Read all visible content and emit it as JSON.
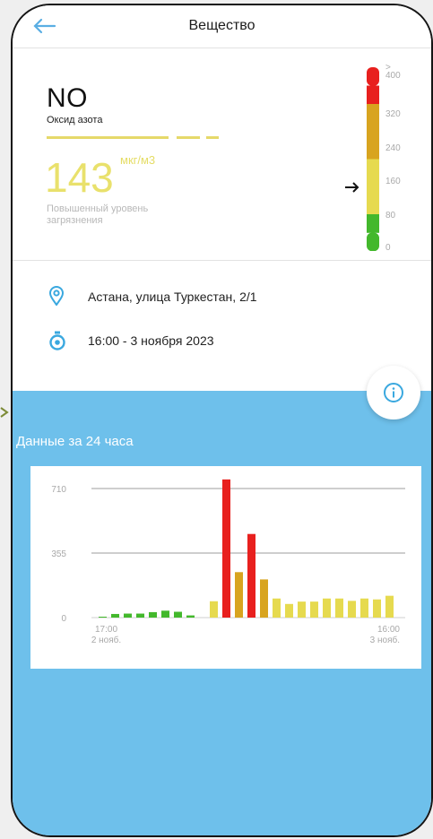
{
  "header": {
    "title": "Вещество",
    "back_icon": "arrow-left-icon"
  },
  "substance": {
    "formula": "NO",
    "name": "Оксид азота",
    "value": "143",
    "unit": "мкг/м3",
    "status": "Повышенный уровень загрязнения",
    "color": "#e9e16c",
    "level_fraction": 0.36
  },
  "scale": {
    "labels": [
      ">\n400",
      "320",
      "240",
      "160",
      "80",
      "0"
    ],
    "segments": [
      {
        "color": "#e8201e"
      },
      {
        "color": "#e8201e"
      },
      {
        "color": "#d8a41f"
      },
      {
        "color": "#d8a41f"
      },
      {
        "color": "#d8a41f"
      },
      {
        "color": "#e6da4f"
      },
      {
        "color": "#e6da4f"
      },
      {
        "color": "#e6da4f"
      },
      {
        "color": "#43b82c"
      },
      {
        "color": "#43b82c"
      }
    ]
  },
  "location": {
    "icon": "location-pin-icon",
    "text": "Астана, улица Туркестан, 2/1"
  },
  "time": {
    "icon": "stopwatch-icon",
    "text": "16:00 - 3 ноября 2023"
  },
  "info_button": {
    "icon": "info-icon"
  },
  "history": {
    "title": "Данные за 24 часа"
  },
  "chart_data": {
    "type": "bar",
    "ylim": [
      0,
      710
    ],
    "y_ticks": [
      "710",
      "355",
      "0"
    ],
    "y_tick_values": [
      710,
      355,
      0
    ],
    "x_labels": [
      {
        "index": 1,
        "time": "17:00",
        "date": "2 нояб."
      },
      {
        "index": 24,
        "time": "16:00",
        "date": "3 нояб."
      }
    ],
    "values": [
      5,
      20,
      22,
      22,
      30,
      38,
      32,
      12,
      90,
      760,
      250,
      460,
      210,
      105,
      75,
      88,
      88,
      105,
      105,
      92,
      105,
      100,
      120
    ],
    "colors": [
      "#43b82c",
      "#43b82c",
      "#43b82c",
      "#43b82c",
      "#43b82c",
      "#43b82c",
      "#43b82c",
      "#43b82c",
      "#e6da4f",
      "#e8201e",
      "#d8a41f",
      "#e8201e",
      "#d8a41f",
      "#e6da4f",
      "#e6da4f",
      "#e6da4f",
      "#e6da4f",
      "#e6da4f",
      "#e6da4f",
      "#e6da4f",
      "#e6da4f",
      "#e6da4f",
      "#e6da4f"
    ],
    "gap_after_index": 7,
    "gap_after_index_2": 12
  }
}
